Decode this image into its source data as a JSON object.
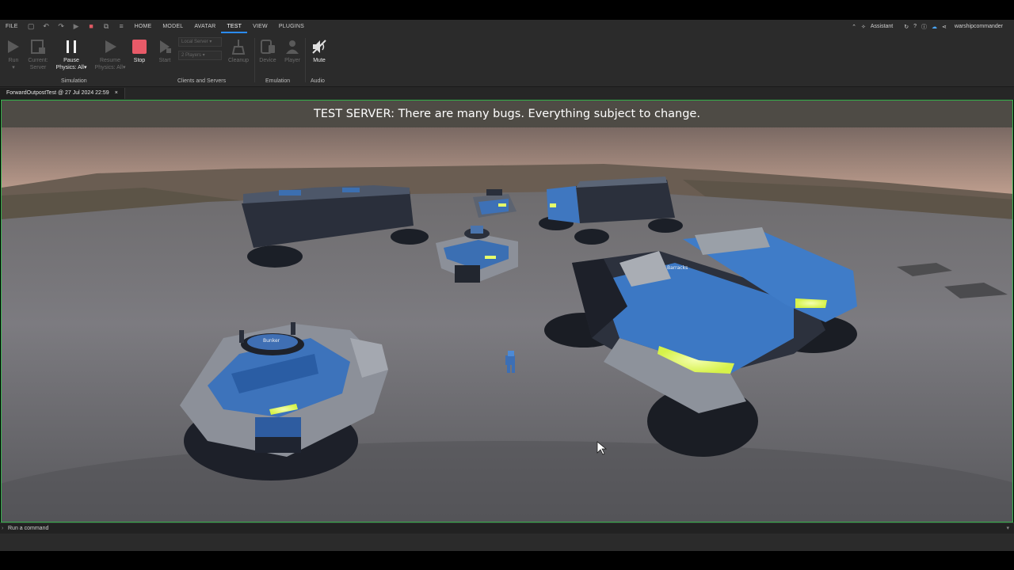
{
  "menu": {
    "file": "FILE",
    "tabs": [
      "HOME",
      "MODEL",
      "AVATAR",
      "TEST",
      "VIEW",
      "PLUGINS"
    ],
    "active_tab": "TEST",
    "assistant": "Assistant",
    "username": "warshipcommander"
  },
  "ribbon": {
    "run": "Run",
    "current_server": "Current: Server",
    "pause": "Pause",
    "physics_all": "Physics: All",
    "resume": "Resume",
    "resume_physics": "Physics: All",
    "stop": "Stop",
    "start": "Start",
    "local_server": "Local Server",
    "players": "2 Players",
    "cleanup": "Cleanup",
    "device": "Device",
    "player": "Player",
    "mute": "Mute",
    "group_simulation": "Simulation",
    "group_clients": "Clients and Servers",
    "group_emulation": "Emulation",
    "group_audio": "Audio"
  },
  "document_tab": {
    "title": "ForwardOutpostTest @ 27 Jul 2024 22:59",
    "close": "×"
  },
  "viewport": {
    "banner": "TEST SERVER: There are many bugs. Everything subject to change.",
    "labels": {
      "bunker": "Bunker",
      "barracks": "Barracks"
    }
  },
  "command_bar": {
    "placeholder": "Run a command"
  },
  "colors": {
    "accent_blue": "#2b8cff",
    "stop_red": "#e85a68",
    "viewport_border": "#33b14a",
    "building_blue": "#3f79c4",
    "glow_yellow": "#e6ff6a"
  }
}
